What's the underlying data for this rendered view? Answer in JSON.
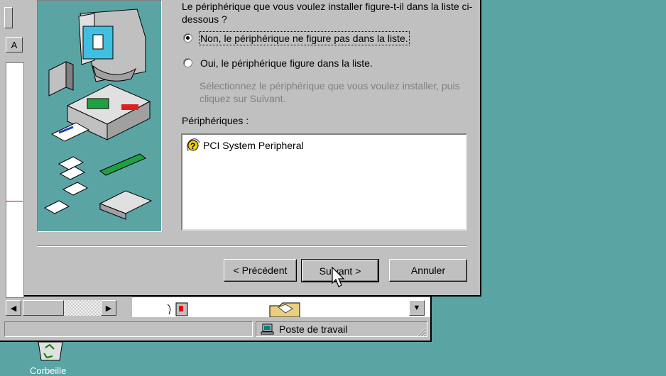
{
  "dialog": {
    "question": "Le périphérique que vous voulez installer figure-t-il dans la liste ci-dessous ?",
    "option_no": "Non, le périphérique ne figure pas dans la liste.",
    "option_yes": "Oui, le périphérique figure dans la liste.",
    "hint": "Sélectionnez le périphérique que vous voulez installer, puis cliquez sur Suivant.",
    "devices_label": "Périphériques :",
    "devices": [
      "PCI System Peripheral"
    ],
    "selected_option": "no",
    "buttons": {
      "back": "< Précédent",
      "next": "Suivant >",
      "cancel": "Annuler"
    }
  },
  "explorer": {
    "left_button_letter": "A",
    "status_computer": "Poste de travail"
  },
  "desktop": {
    "recycle_bin_label": "Corbeille"
  },
  "colors": {
    "desktop": "#5aa4a4",
    "face": "#c0c0c0"
  }
}
